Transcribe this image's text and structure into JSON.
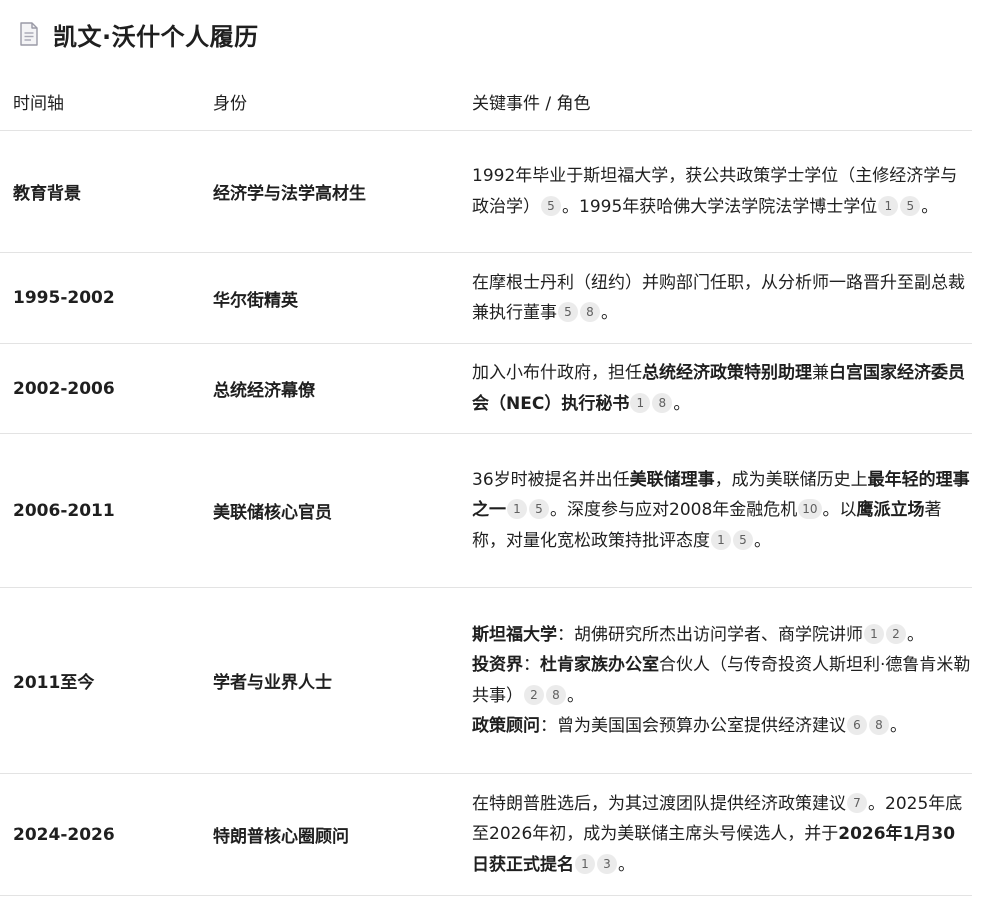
{
  "title": {
    "icon": "document-icon",
    "text": "凯文·沃什个人履历"
  },
  "table": {
    "headers": [
      "时间轴",
      "身份",
      "关键事件 / 角色"
    ],
    "rows": [
      {
        "time": "教育背景",
        "role": "经济学与法学高材生",
        "segments": [
          {
            "t": "1992年毕业于斯坦福大学，获公共政策学士学位（主修经济学与政治学）"
          },
          {
            "c": "5"
          },
          {
            "t": "。1995年获哈佛大学法学院法学博士学位"
          },
          {
            "c": "1"
          },
          {
            "c": "5"
          },
          {
            "t": "。"
          }
        ]
      },
      {
        "time": "1995-2002",
        "role": "华尔街精英",
        "segments": [
          {
            "t": "在摩根士丹利（纽约）并购部门任职，从分析师一路晋升至副总裁兼执行董事"
          },
          {
            "c": "5"
          },
          {
            "c": "8"
          },
          {
            "t": "。"
          }
        ]
      },
      {
        "time": "2002-2006",
        "role": "总统经济幕僚",
        "segments": [
          {
            "t": "加入小布什政府，担任"
          },
          {
            "b": "总统经济政策特别助理"
          },
          {
            "t": "兼"
          },
          {
            "b": "白宫国家经济委员会（NEC）执行秘书"
          },
          {
            "c": "1"
          },
          {
            "c": "8"
          },
          {
            "t": "。"
          }
        ]
      },
      {
        "time": "2006-2011",
        "role": "美联储核心官员",
        "segments": [
          {
            "t": "36岁时被提名并出任"
          },
          {
            "b": "美联储理事"
          },
          {
            "t": "，成为美联储历史上"
          },
          {
            "b": "最年轻的理事之一"
          },
          {
            "c": "1"
          },
          {
            "c": "5"
          },
          {
            "t": "。深度参与应对2008年金融危机"
          },
          {
            "c": "10"
          },
          {
            "t": "。以"
          },
          {
            "b": "鹰派立场"
          },
          {
            "t": "著称，对量化宽松政策持批评态度"
          },
          {
            "c": "1"
          },
          {
            "c": "5"
          },
          {
            "t": "。"
          }
        ]
      },
      {
        "time": "2011至今",
        "role": "学者与业界人士",
        "lines": [
          [
            {
              "b": "斯坦福大学"
            },
            {
              "t": "：胡佛研究所杰出访问学者、商学院讲师"
            },
            {
              "c": "1"
            },
            {
              "c": "2"
            },
            {
              "t": "。"
            }
          ],
          [
            {
              "b": "投资界"
            },
            {
              "t": "："
            },
            {
              "b": "杜肯家族办公室"
            },
            {
              "t": "合伙人（与传奇投资人斯坦利·德鲁肯米勒共事）"
            },
            {
              "c": "2"
            },
            {
              "c": "8"
            },
            {
              "t": "。"
            }
          ],
          [
            {
              "b": "政策顾问"
            },
            {
              "t": "：曾为美国国会预算办公室提供经济建议"
            },
            {
              "c": "6"
            },
            {
              "c": "8"
            },
            {
              "t": "。"
            }
          ]
        ]
      },
      {
        "time": "2024-2026",
        "role": "特朗普核心圈顾问",
        "segments": [
          {
            "t": "在特朗普胜选后，为其过渡团队提供经济政策建议"
          },
          {
            "c": "7"
          },
          {
            "t": "。2025年底至2026年初，成为美联储主席头号候选人，并于"
          },
          {
            "b": "2026年1月30日获正式提名"
          },
          {
            "c": "1"
          },
          {
            "c": "3"
          },
          {
            "t": "。"
          }
        ]
      }
    ]
  }
}
